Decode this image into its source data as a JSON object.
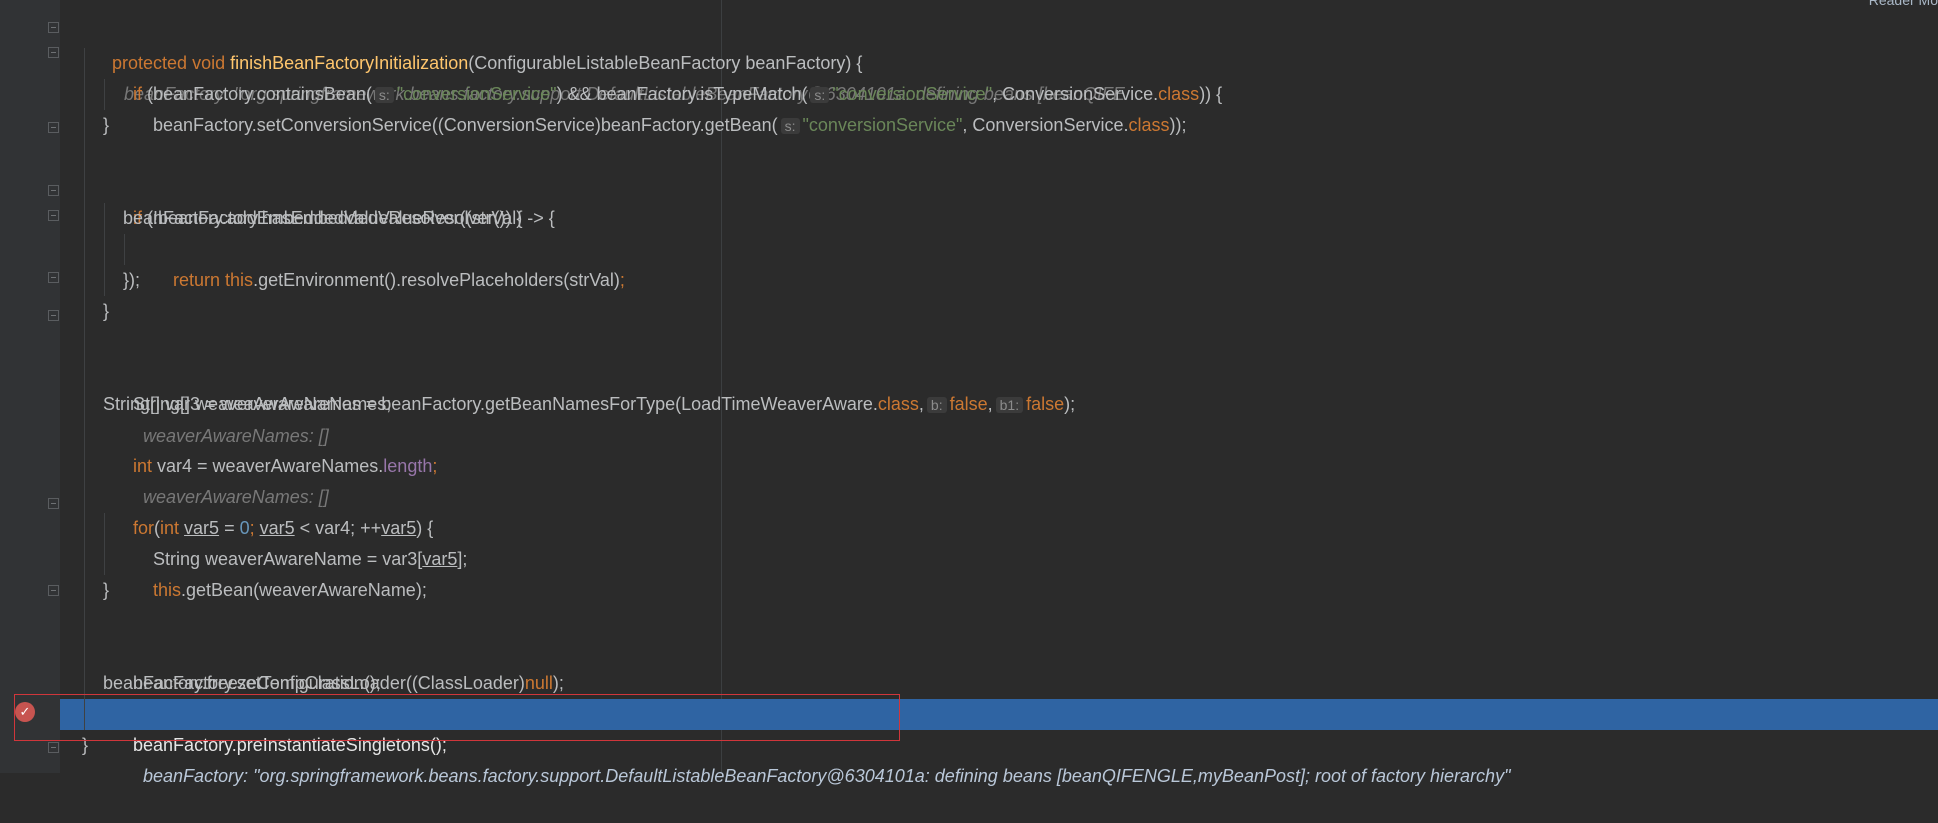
{
  "app": {
    "reader_mode_label": "Reader Mo"
  },
  "lines": {
    "l1": {
      "a": "protected void ",
      "b": "finishBeanFactoryInitialization",
      "c": "(ConfigurableListableBeanFactory beanFactory) {",
      "inline": "beanFactory: \"org.springframework.beans.factory.support.DefaultListableBeanFactory@6304101a: defining beans [beanQIFE"
    },
    "l2": {
      "a": "if ",
      "b": "(beanFactory.containsBean(",
      "hint1": "s:",
      "s1": "\"conversionService\"",
      "c": ") && beanFactory.isTypeMatch(",
      "hint2": "s:",
      "s2": "\"conversionService\"",
      "d": ", ConversionService.",
      "e": "class",
      "f": ")) {"
    },
    "l3": {
      "a": "beanFactory.setConversionService((ConversionService)beanFactory.getBean(",
      "hint": "s:",
      "s": "\"conversionService\"",
      "b": ", ConversionService.",
      "c": "class",
      "d": "));"
    },
    "l4": {
      "a": "}"
    },
    "l6": {
      "a": "if ",
      "b": "(!beanFactory.hasEmbeddedValueResolver()) {"
    },
    "l7": {
      "a": "beanFactory.addEmbeddedValueResolver((strVal) -> {"
    },
    "l8": {
      "a": "return ",
      "b": "this",
      "c": ".getEnvironment().resolvePlaceholders(strVal)",
      "d": ";"
    },
    "l9": {
      "a": "});"
    },
    "l10": {
      "a": "}"
    },
    "l12": {
      "a": "String[] weaverAwareNames = beanFactory.getBeanNamesForType(LoadTimeWeaverAware.",
      "b": "class",
      "c": ",",
      "hint1": "b:",
      "v1": "false",
      "c2": ",",
      "hint2": "b1:",
      "v2": "false",
      "d": ");",
      "inline": "weaverAwareNames: []"
    },
    "l13": {
      "a": "String[] var3 = weaverAwareNames;"
    },
    "l14": {
      "a": "int ",
      "b": "var4 = weaverAwareNames.",
      "c": "length",
      "d": ";",
      "inline": "weaverAwareNames: []"
    },
    "l16": {
      "a": "for",
      "b": "(",
      "c": "int ",
      "v": "var5",
      "d": " = ",
      "n": "0",
      "e": "; ",
      "v2": "var5",
      "f": " < var4; ++",
      "v3": "var5",
      "g": ") {"
    },
    "l17": {
      "a": "String weaverAwareName = var3[",
      "v": "var5",
      "b": "];"
    },
    "l18": {
      "a": "this",
      "b": ".getBean(weaverAwareName);"
    },
    "l19": {
      "a": "}"
    },
    "l21": {
      "a": "beanFactory.setTempClassLoader((ClassLoader)",
      "b": "null",
      "c": ");"
    },
    "l22": {
      "a": "beanFactory.freezeConfiguration();"
    },
    "l23": {
      "a": "beanFactory.preInstantiateSingletons();",
      "inline": "beanFactory: \"org.springframework.beans.factory.support.DefaultListableBeanFactory@6304101a: defining beans [beanQIFENGLE,myBeanPost]; root of factory hierarchy\""
    },
    "l24": {
      "a": "}"
    }
  },
  "gutter": {
    "breakpoint_icon": "breakpoint-check-icon",
    "fold_icon": "fold-marker-icon"
  },
  "colors": {
    "background": "#2b2b2b",
    "current_line": "#2f64a3",
    "keyword": "#cc7832",
    "string": "#6a8759",
    "highlight_box": "#d0363b"
  }
}
